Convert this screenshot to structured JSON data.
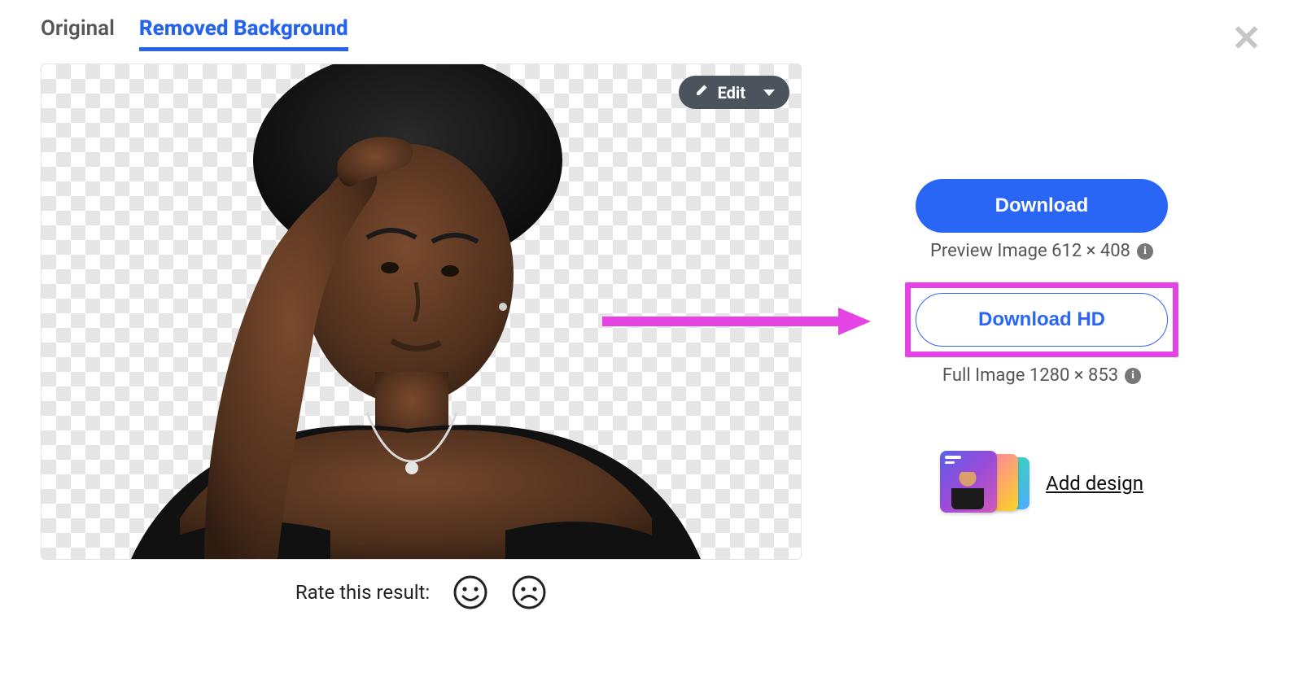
{
  "tabs": {
    "original": "Original",
    "removed_bg": "Removed Background"
  },
  "edit_button": "Edit",
  "rate": {
    "label": "Rate this result:"
  },
  "download": {
    "primary_label": "Download",
    "preview_caption": "Preview Image 612 × 408",
    "hd_label": "Download HD",
    "full_caption": "Full Image 1280 × 853"
  },
  "add_design_label": "Add design",
  "close_glyph": "✕"
}
